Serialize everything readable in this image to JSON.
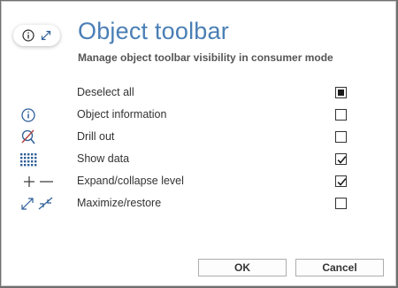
{
  "dialog": {
    "title": "Object toolbar",
    "subtitle": "Manage object toolbar visibility in consumer mode",
    "header_icons": [
      "info-icon",
      "expand-icon"
    ],
    "accent_color": "#4a7fb5"
  },
  "options": [
    {
      "label": "Deselect all",
      "icon": "none",
      "state": "indeterminate"
    },
    {
      "label": "Object information",
      "icon": "info-icon",
      "state": "unchecked"
    },
    {
      "label": "Drill out",
      "icon": "drill-out-icon",
      "state": "unchecked"
    },
    {
      "label": "Show data",
      "icon": "grid-icon",
      "state": "checked"
    },
    {
      "label": "Expand/collapse level",
      "icon": "plus-minus-icon",
      "state": "checked"
    },
    {
      "label": "Maximize/restore",
      "icon": "maximize-restore-icon",
      "state": "unchecked"
    }
  ],
  "buttons": {
    "ok": "OK",
    "cancel": "Cancel"
  }
}
